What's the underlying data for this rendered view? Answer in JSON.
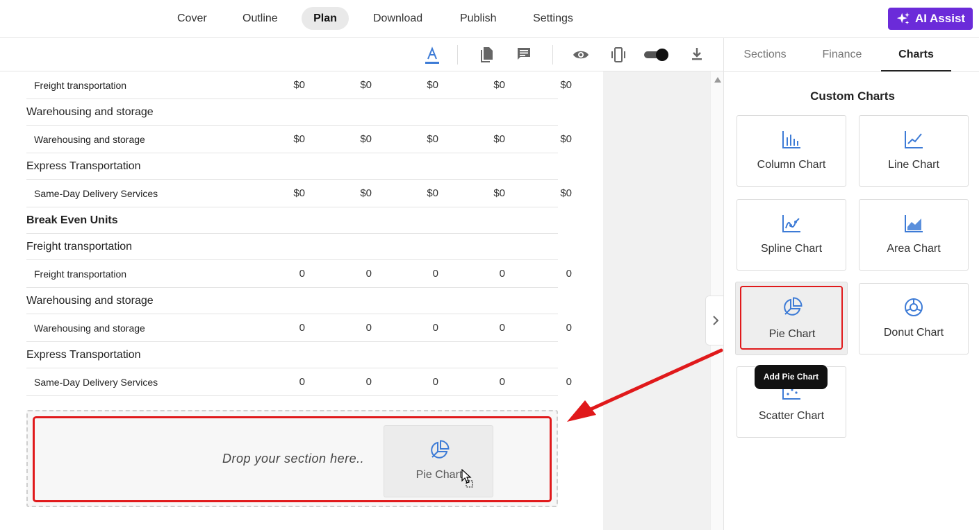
{
  "nav": {
    "tabs": [
      "Cover",
      "Outline",
      "Plan",
      "Download",
      "Publish",
      "Settings"
    ],
    "active_tab": "Plan",
    "ai_button": "AI Assist"
  },
  "toolbar": {
    "icons": [
      "text-format-icon",
      "document-icon",
      "comment-icon",
      "eye-icon",
      "mobile-preview-icon",
      "toggle-switch",
      "download-icon"
    ]
  },
  "table": {
    "rows": [
      {
        "label": "Freight transportation",
        "type": "sub",
        "values": [
          "$0",
          "$0",
          "$0",
          "$0",
          "$0"
        ]
      },
      {
        "label": "Warehousing and storage",
        "type": "group",
        "values": []
      },
      {
        "label": "Warehousing and storage",
        "type": "sub",
        "values": [
          "$0",
          "$0",
          "$0",
          "$0",
          "$0"
        ]
      },
      {
        "label": "Express Transportation",
        "type": "group",
        "values": []
      },
      {
        "label": "Same-Day Delivery Services",
        "type": "sub",
        "values": [
          "$0",
          "$0",
          "$0",
          "$0",
          "$0"
        ]
      },
      {
        "label": "Break Even Units",
        "type": "head",
        "values": []
      },
      {
        "label": "Freight transportation",
        "type": "group",
        "values": []
      },
      {
        "label": "Freight transportation",
        "type": "sub",
        "values": [
          "0",
          "0",
          "0",
          "0",
          "0"
        ]
      },
      {
        "label": "Warehousing and storage",
        "type": "group",
        "values": []
      },
      {
        "label": "Warehousing and storage",
        "type": "sub",
        "values": [
          "0",
          "0",
          "0",
          "0",
          "0"
        ]
      },
      {
        "label": "Express Transportation",
        "type": "group",
        "values": []
      },
      {
        "label": "Same-Day Delivery Services",
        "type": "sub",
        "values": [
          "0",
          "0",
          "0",
          "0",
          "0"
        ]
      }
    ]
  },
  "dropzone": {
    "text": "Drop your section here..",
    "dragged_item": "Pie Chart"
  },
  "panel": {
    "tabs": [
      "Sections",
      "Finance",
      "Charts"
    ],
    "active_tab": "Charts",
    "title": "Custom Charts",
    "charts": [
      {
        "label": "Column Chart",
        "icon": "column-chart-icon"
      },
      {
        "label": "Line Chart",
        "icon": "line-chart-icon"
      },
      {
        "label": "Spline Chart",
        "icon": "spline-chart-icon"
      },
      {
        "label": "Area Chart",
        "icon": "area-chart-icon"
      },
      {
        "label": "Pie Chart",
        "icon": "pie-chart-icon"
      },
      {
        "label": "Donut Chart",
        "icon": "donut-chart-icon"
      },
      {
        "label": "Scatter Chart",
        "icon": "scatter-chart-icon"
      }
    ],
    "tooltip": "Add Pie Chart"
  },
  "colors": {
    "accent": "#6b2bd9",
    "icon_blue": "#3d7bd6",
    "highlight_red": "#e0191b"
  }
}
